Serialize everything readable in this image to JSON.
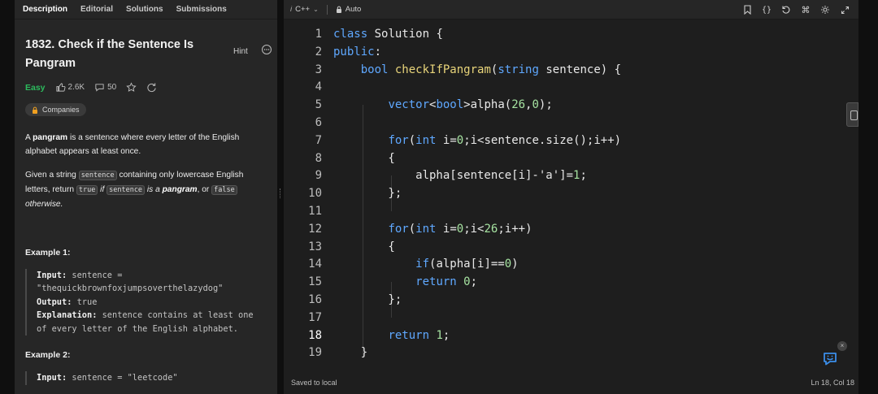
{
  "tabs": [
    {
      "label": "Description"
    },
    {
      "label": "Editorial"
    },
    {
      "label": "Solutions"
    },
    {
      "label": "Submissions"
    }
  ],
  "problem": {
    "title": "1832. Check if the Sentence Is Pangram",
    "hint_label": "Hint",
    "difficulty": "Easy",
    "likes": "2.6K",
    "comments": "50",
    "companies_label": "Companies"
  },
  "description": {
    "p1_pre": "A ",
    "p1_bold": "pangram",
    "p1_post": " is a sentence where every letter of the English alphabet appears at least once.",
    "p2_a": "Given a string ",
    "p2_code1": "sentence",
    "p2_b": " containing only lowercase English letters, return ",
    "p2_code2": "true",
    "p2_c": " if ",
    "p2_code3": "sentence",
    "p2_d": " is a ",
    "p2_bold": "pangram",
    "p2_e": ", or ",
    "p2_code4": "false",
    "p2_f": " otherwise."
  },
  "examples": [
    {
      "title": "Example 1:",
      "input_label": "Input:",
      "input_value": "sentence = \"thequickbrownfoxjumpsoverthelazydog\"",
      "output_label": "Output:",
      "output_value": "true",
      "explanation_label": "Explanation:",
      "explanation_value": "sentence contains at least one of every letter of the English alphabet."
    },
    {
      "title": "Example 2:",
      "input_label": "Input:",
      "input_value": "sentence = \"leetcode\""
    }
  ],
  "editor": {
    "language": "C++",
    "mode": "Auto",
    "status_left": "Saved to local",
    "status_right": "Ln 18, Col 18"
  },
  "code_lines": [
    "class Solution {",
    "public:",
    "    bool checkIfPangram(string sentence) {",
    "",
    "        vector<bool>alpha(26,0);",
    "",
    "        for(int i=0;i<sentence.size();i++)",
    "        {",
    "            alpha[sentence[i]-'a']=1;",
    "        };",
    "",
    "        for(int i=0;i<26;i++)",
    "        {",
    "            if(alpha[i]==0)",
    "            return 0;",
    "        };",
    "",
    "        return 1;",
    "    }"
  ],
  "colors": {
    "easy": "#2cbb5d",
    "keyword": "#5fa8ff",
    "background": "#1e1e1e"
  },
  "icons": [
    "like-icon",
    "comment-icon",
    "star-icon",
    "share-icon",
    "lock-icon",
    "bookmark-icon",
    "braces-icon",
    "reset-icon",
    "shortcut-icon",
    "settings-icon",
    "fullscreen-icon",
    "feedback-icon"
  ]
}
